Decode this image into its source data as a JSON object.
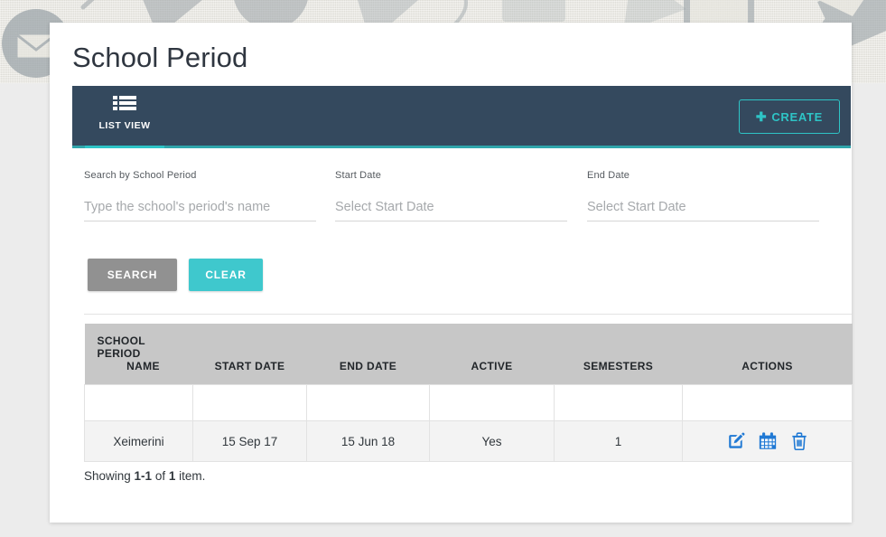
{
  "page": {
    "title": "School Period",
    "background_top_color": "#e6e5de",
    "background_color": "#ececec",
    "card_color": "#ffffff"
  },
  "view_bar": {
    "background_color": "#34495e",
    "accent_color": "#2ec4c6",
    "tab": {
      "icon": "list-view-icon",
      "label": "LIST VIEW"
    },
    "create_button": {
      "icon": "plus-icon",
      "plus": "✚",
      "label": "CREATE"
    }
  },
  "filters": {
    "name_field": {
      "label": "Search by School Period",
      "placeholder": "Type the school's period's name",
      "value": ""
    },
    "start_date_field": {
      "label": "Start Date",
      "placeholder": "Select Start Date",
      "value": ""
    },
    "end_date_field": {
      "label": "End Date",
      "placeholder": "Select Start Date",
      "value": ""
    },
    "search_button": {
      "label": "SEARCH",
      "color": "#919191"
    },
    "clear_button": {
      "label": "CLEAR",
      "color": "#3fc8cd"
    }
  },
  "table": {
    "header_background": "#c7c7c7",
    "columns": [
      {
        "line1": "SCHOOL PERIOD",
        "line2": "NAME"
      },
      {
        "line1": "START DATE",
        "line2": ""
      },
      {
        "line1": "END DATE",
        "line2": ""
      },
      {
        "line1": "ACTIVE",
        "line2": ""
      },
      {
        "line1": "SEMESTERS",
        "line2": ""
      },
      {
        "line1": "ACTIONS",
        "line2": ""
      }
    ],
    "filter_row": [
      "",
      "",
      "",
      "",
      "",
      ""
    ],
    "rows": [
      {
        "name": "Xeimerini",
        "start_date": "15 Sep 17",
        "end_date": "15 Jun 18",
        "active": "Yes",
        "semesters": "1",
        "actions": [
          "edit-icon",
          "calendar-icon",
          "delete-icon"
        ]
      }
    ],
    "action_icon_color": "#2079d4"
  },
  "footer": {
    "showing_prefix": "Showing ",
    "range": "1-1",
    "of": " of ",
    "total": "1",
    "suffix": " item."
  }
}
